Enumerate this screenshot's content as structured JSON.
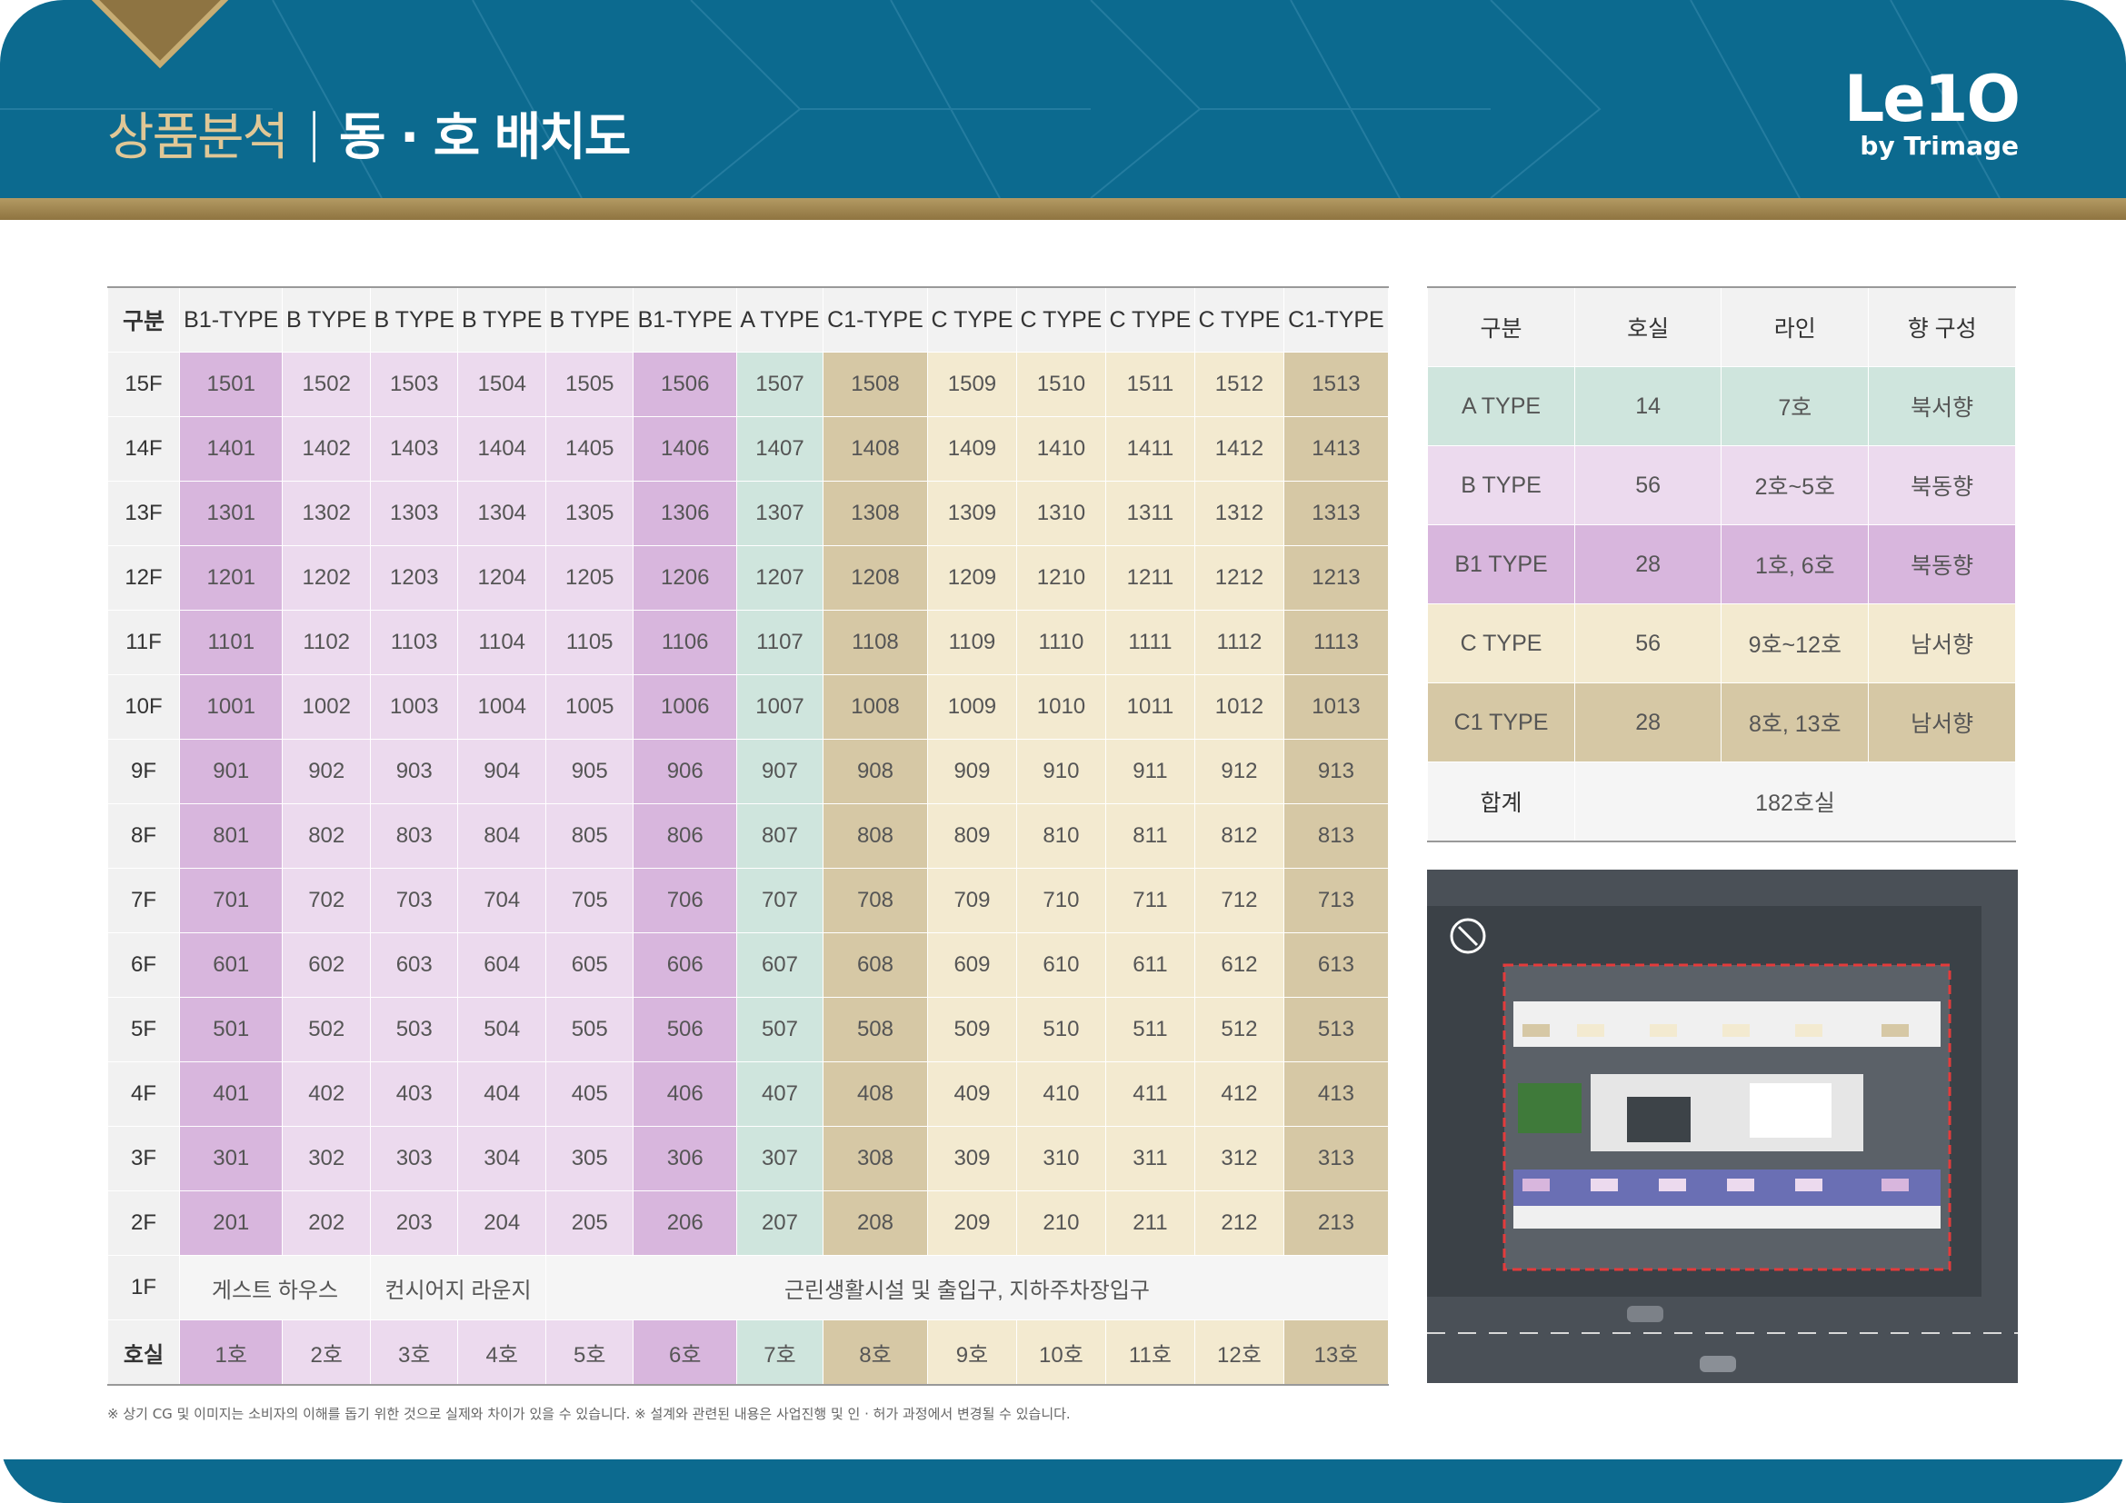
{
  "header": {
    "title_prefix": "상품분석",
    "title_sep": "|",
    "title_main": "동 · 호 배치도",
    "logo_main": "Le1O",
    "logo_sub": "by Trimage"
  },
  "colors": {
    "header_blue": "#0c6a8f",
    "gold": "#b39a63",
    "b1_type": "#d8b6dd",
    "b_type": "#ecdaee",
    "a_type": "#cfe5dd",
    "c1_type": "#d6c8a5",
    "c_type": "#f3ead0"
  },
  "unit_table": {
    "corner": "구분",
    "columns": [
      "B1-TYPE",
      "B TYPE",
      "B TYPE",
      "B TYPE",
      "B TYPE",
      "B1-TYPE",
      "A TYPE",
      "C1-TYPE",
      "C TYPE",
      "C TYPE",
      "C TYPE",
      "C TYPE",
      "C1-TYPE"
    ],
    "floors": [
      {
        "label": "15F",
        "units": [
          "1501",
          "1502",
          "1503",
          "1504",
          "1505",
          "1506",
          "1507",
          "1508",
          "1509",
          "1510",
          "1511",
          "1512",
          "1513"
        ]
      },
      {
        "label": "14F",
        "units": [
          "1401",
          "1402",
          "1403",
          "1404",
          "1405",
          "1406",
          "1407",
          "1408",
          "1409",
          "1410",
          "1411",
          "1412",
          "1413"
        ]
      },
      {
        "label": "13F",
        "units": [
          "1301",
          "1302",
          "1303",
          "1304",
          "1305",
          "1306",
          "1307",
          "1308",
          "1309",
          "1310",
          "1311",
          "1312",
          "1313"
        ]
      },
      {
        "label": "12F",
        "units": [
          "1201",
          "1202",
          "1203",
          "1204",
          "1205",
          "1206",
          "1207",
          "1208",
          "1209",
          "1210",
          "1211",
          "1212",
          "1213"
        ]
      },
      {
        "label": "11F",
        "units": [
          "1101",
          "1102",
          "1103",
          "1104",
          "1105",
          "1106",
          "1107",
          "1108",
          "1109",
          "1110",
          "1111",
          "1112",
          "1113"
        ]
      },
      {
        "label": "10F",
        "units": [
          "1001",
          "1002",
          "1003",
          "1004",
          "1005",
          "1006",
          "1007",
          "1008",
          "1009",
          "1010",
          "1011",
          "1012",
          "1013"
        ]
      },
      {
        "label": "9F",
        "units": [
          "901",
          "902",
          "903",
          "904",
          "905",
          "906",
          "907",
          "908",
          "909",
          "910",
          "911",
          "912",
          "913"
        ]
      },
      {
        "label": "8F",
        "units": [
          "801",
          "802",
          "803",
          "804",
          "805",
          "806",
          "807",
          "808",
          "809",
          "810",
          "811",
          "812",
          "813"
        ]
      },
      {
        "label": "7F",
        "units": [
          "701",
          "702",
          "703",
          "704",
          "705",
          "706",
          "707",
          "708",
          "709",
          "710",
          "711",
          "712",
          "713"
        ]
      },
      {
        "label": "6F",
        "units": [
          "601",
          "602",
          "603",
          "604",
          "605",
          "606",
          "607",
          "608",
          "609",
          "610",
          "611",
          "612",
          "613"
        ]
      },
      {
        "label": "5F",
        "units": [
          "501",
          "502",
          "503",
          "504",
          "505",
          "506",
          "507",
          "508",
          "509",
          "510",
          "511",
          "512",
          "513"
        ]
      },
      {
        "label": "4F",
        "units": [
          "401",
          "402",
          "403",
          "404",
          "405",
          "406",
          "407",
          "408",
          "409",
          "410",
          "411",
          "412",
          "413"
        ]
      },
      {
        "label": "3F",
        "units": [
          "301",
          "302",
          "303",
          "304",
          "305",
          "306",
          "307",
          "308",
          "309",
          "310",
          "311",
          "312",
          "313"
        ]
      },
      {
        "label": "2F",
        "units": [
          "201",
          "202",
          "203",
          "204",
          "205",
          "206",
          "207",
          "208",
          "209",
          "210",
          "211",
          "212",
          "213"
        ]
      }
    ],
    "ground": {
      "label": "1F",
      "guest_house": "게스트 하우스",
      "concierge": "컨시어지 라운지",
      "retail": "근린생활시설 및 출입구, 지하주차장입구"
    },
    "line_label": "호실",
    "lines": [
      "1호",
      "2호",
      "3호",
      "4호",
      "5호",
      "6호",
      "7호",
      "8호",
      "9호",
      "10호",
      "11호",
      "12호",
      "13호"
    ]
  },
  "summary_table": {
    "headers": [
      "구분",
      "호실",
      "라인",
      "향 구성"
    ],
    "rows": [
      {
        "type": "A TYPE",
        "count": "14",
        "line": "7호",
        "direction": "북서향"
      },
      {
        "type": "B TYPE",
        "count": "56",
        "line": "2호~5호",
        "direction": "북동향"
      },
      {
        "type": "B1 TYPE",
        "count": "28",
        "line": "1호, 6호",
        "direction": "북동향"
      },
      {
        "type": "C TYPE",
        "count": "56",
        "line": "9호~12호",
        "direction": "남서향"
      },
      {
        "type": "C1 TYPE",
        "count": "28",
        "line": "8호, 13호",
        "direction": "남서향"
      }
    ],
    "total_label": "합계",
    "total_value": "182호실"
  },
  "note": "※ 상기 CG 및 이미지는 소비자의 이해를 돕기 위한 것으로 실제와 차이가 있을 수 있습니다.  ※ 설계와 관련된 내용은 사업진행 및 인 · 허가 과정에서 변경될 수 있습니다."
}
